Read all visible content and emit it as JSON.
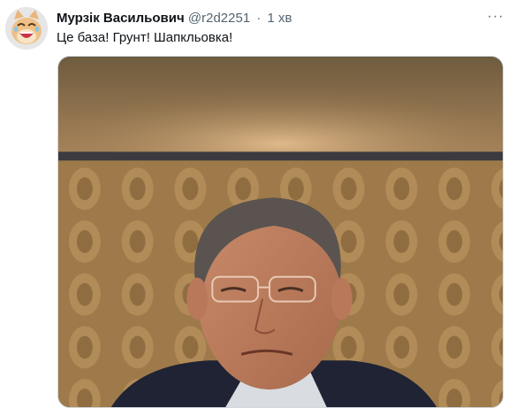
{
  "tweet": {
    "author_name": "Мурзік Васильович",
    "handle": "@r2d2251",
    "separator": "·",
    "time": "1 хв",
    "text": "Це база! Грунт! Шапкльовка!",
    "more_icon": "more-horizontal-icon",
    "avatar_icon": "laughing-cat-avatar"
  },
  "colors": {
    "name": "#0f1419",
    "secondary": "#536471",
    "border": "#cfd9de"
  }
}
